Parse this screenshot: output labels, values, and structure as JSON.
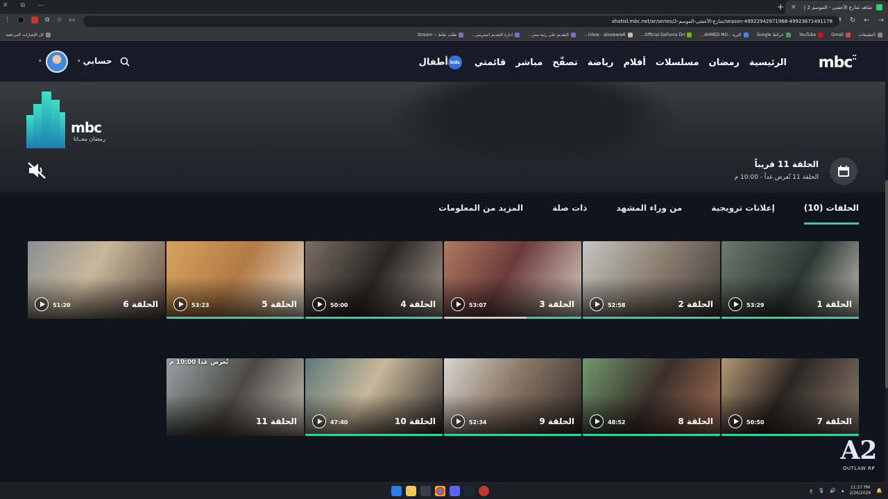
{
  "browser": {
    "tab_title": "شاهد شارع الأعشى - الموسم 2 |",
    "url": "shahid.mbc.net/ar/series/شارع-الأعشى-الموسم-2/season-499229429719​68-49923671491178",
    "bookmarks": [
      "التطبيقات",
      "Gmail",
      "YouTube",
      "خرائط Google",
      "البريد - AHMED MO...",
      "Official GeForce Dri...",
      "Inbox - alosiewie6...",
      "التقديم على رتبة ستر...",
      "ادارة التقديم استريمر...",
      "طلب نقاط -- Stream"
    ],
    "all_bookmarks": "كل الإشارات المرجعية"
  },
  "header": {
    "logo": "mbc",
    "nav": [
      "الرئيسية",
      "رمضان",
      "مسلسلات",
      "أفلام",
      "رياضة",
      "تصفّح",
      "مباشر",
      "قائمتي"
    ],
    "kids_label": "أطفال",
    "kids_badge": "kids",
    "account_label": "حسابي"
  },
  "hero": {
    "brand": "mbc",
    "brand_sub": "رمضان معــانا",
    "next_title": "الحلقة 11 قريباً",
    "next_sub": "الحلقة 11 تُعرض غداً - 10:00 م"
  },
  "tabs": [
    "الحلقات (10)",
    "إعلانات ترويجية",
    "من وراء المشهد",
    "ذات صلة",
    "المزيد من المعلومات"
  ],
  "episodes_row1": [
    {
      "title": "الحلقة 1",
      "duration": "53:29"
    },
    {
      "title": "الحلقة 2",
      "duration": "52:58"
    },
    {
      "title": "الحلقة 3",
      "duration": "53:07"
    },
    {
      "title": "الحلقة 4",
      "duration": "50:00"
    },
    {
      "title": "الحلقة 5",
      "duration": "53:23"
    },
    {
      "title": "الحلقة 6",
      "duration": "51:20"
    }
  ],
  "episodes_row2": [
    {
      "title": "الحلقة 7",
      "duration": "50:50"
    },
    {
      "title": "الحلقة 8",
      "duration": "48:52"
    },
    {
      "title": "الحلقة 9",
      "duration": "52:34"
    },
    {
      "title": "الحلقة 10",
      "duration": "47:40"
    },
    {
      "title": "الحلقة 11",
      "soon": "تُعرض غداً 10:00 م"
    }
  ],
  "watermark": {
    "big": "A2",
    "small": "OUTLAW RP"
  },
  "taskbar": {
    "time": "11:37 PM",
    "date": "2/26/2026",
    "lang": "ع"
  },
  "colors": {
    "accent": "#2fd3a6",
    "background": "#10141d"
  }
}
